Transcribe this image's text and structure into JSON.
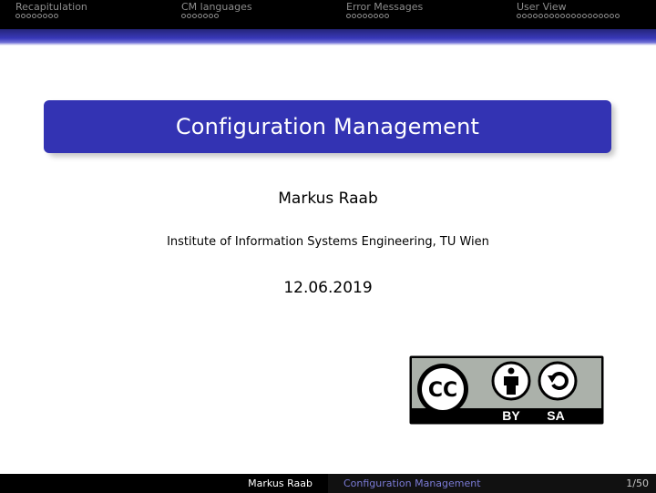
{
  "nav": {
    "sections": [
      {
        "title": "Recapitulation",
        "dots": 8
      },
      {
        "title": "CM languages",
        "dots": 7
      },
      {
        "title": "Error Messages",
        "dots": 8
      },
      {
        "title": "User View",
        "dots": 19
      }
    ]
  },
  "title": "Configuration Management",
  "author": "Markus Raab",
  "institute": "Institute of Information Systems Engineering, TU Wien",
  "date": "12.06.2019",
  "license": {
    "cc_text": "CC",
    "by_text": "BY",
    "sa_text": "SA"
  },
  "footer": {
    "author": "Markus Raab",
    "title": "Configuration Management",
    "page": "1/50"
  },
  "colors": {
    "title_box": "#3333b3",
    "footer_title": "#7b7bd6",
    "nav_text": "#8c8c8c"
  }
}
